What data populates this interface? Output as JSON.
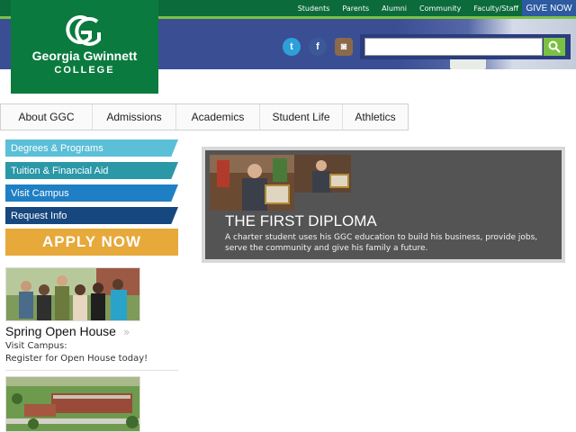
{
  "top_nav": {
    "links": [
      "Students",
      "Parents",
      "Alumni",
      "Community",
      "Faculty/Staff"
    ],
    "give_label": "GIVE NOW"
  },
  "logo": {
    "name": "Georgia Gwinnett",
    "sub": "COLLEGE"
  },
  "social": {
    "twitter_glyph": "t",
    "facebook_glyph": "f",
    "instagram_glyph": "◙"
  },
  "search": {
    "placeholder": "",
    "icon": "search-icon"
  },
  "main_nav": {
    "items": [
      "About GGC",
      "Admissions",
      "Academics",
      "Student Life",
      "Athletics"
    ]
  },
  "side_menu": {
    "items": [
      {
        "label": "Degrees & Programs",
        "color": "#5bbfd8"
      },
      {
        "label": "Tuition & Financial Aid",
        "color": "#2b98a8"
      },
      {
        "label": "Visit Campus",
        "color": "#1f7fc4"
      },
      {
        "label": "Request Info",
        "color": "#17477f"
      }
    ],
    "apply_label": "APPLY NOW"
  },
  "open_house": {
    "title": "Spring Open House",
    "arrow": "»",
    "line1": "Visit Campus:",
    "line2": "Register for Open House today!"
  },
  "feature": {
    "title": "THE FIRST DIPLOMA",
    "text": "A charter student uses his GGC education to build his business, provide jobs, serve the community and give his family a future."
  },
  "colors": {
    "brand_green": "#0b7a3e",
    "accent_green": "#7ac143",
    "banner_blue": "#3a4e94",
    "apply_gold": "#e6a93a"
  }
}
